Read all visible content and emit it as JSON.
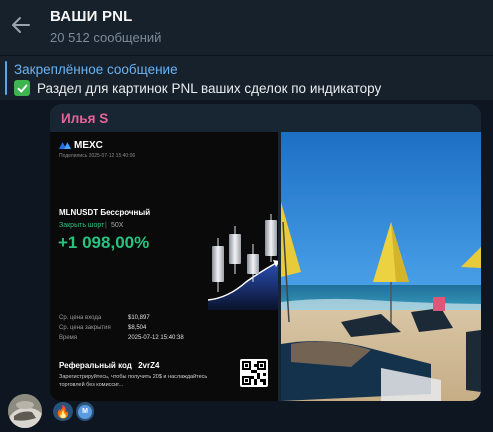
{
  "header": {
    "title": "ВАШИ PNL",
    "subtitle": "20 512 сообщений"
  },
  "pinned": {
    "title": "Закреплённое сообщение",
    "text": "Раздел для картинок PNL ваших сделок по индикатору"
  },
  "message": {
    "sender": "Илья S",
    "sender_color": "#e6649b",
    "card": {
      "brand": "MEXC",
      "shared_at": "Поделились 2025-07-12 15:40:06",
      "pair": "MLNUSDT Бессрочный",
      "side": "Закрыть шорт",
      "separator": "|",
      "leverage": "50X",
      "pnl": "+1 098,00%",
      "rows": [
        {
          "label": "Ср. цена входа",
          "value": "$10,897"
        },
        {
          "label": "Ср. цена закрытия",
          "value": "$8,504"
        },
        {
          "label": "Время",
          "value": "2025-07-12 15:40:38"
        }
      ],
      "referral_label": "Реферальный код",
      "referral_code": "2vrZ4",
      "promo": "Зарегистрируйтесь, чтобы получить 20$ и наслаждайтесь торговлей без комиссиг..."
    }
  },
  "reactions": [
    {
      "icon": "fire",
      "emoji": "🔥"
    },
    {
      "icon": "avatar-m",
      "letter": "M"
    }
  ],
  "colors": {
    "background": "#0e1621",
    "header": "#17212b",
    "bubble": "#182533",
    "accent": "#6ab3f3",
    "profit_green": "#27c27f"
  }
}
